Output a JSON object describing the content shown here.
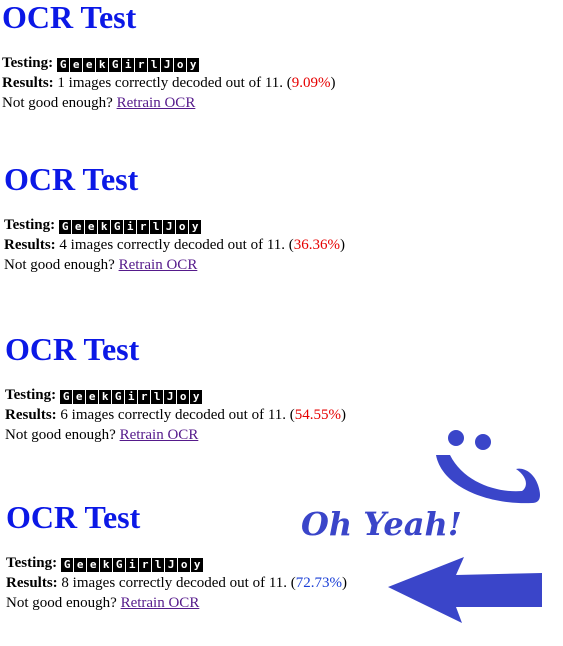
{
  "glyph_text": [
    "G",
    "e",
    "e",
    "k",
    "G",
    "i",
    "r",
    "l",
    "J",
    "o",
    "y"
  ],
  "panels": [
    {
      "title": "OCR Test",
      "testing_label": "Testing:",
      "results_label": "Results:",
      "results_text": " 1 images correctly decoded out of 11. (",
      "percent": "9.09%",
      "percent_color": "#e60000",
      "results_close": ")",
      "retrain_prompt": "Not good enough? ",
      "retrain_link": "Retrain OCR"
    },
    {
      "title": "OCR Test",
      "testing_label": "Testing:",
      "results_label": "Results:",
      "results_text": " 4 images correctly decoded out of 11. (",
      "percent": "36.36%",
      "percent_color": "#e60000",
      "results_close": ")",
      "retrain_prompt": "Not good enough? ",
      "retrain_link": "Retrain OCR"
    },
    {
      "title": "OCR Test",
      "testing_label": "Testing:",
      "results_label": "Results:",
      "results_text": " 6 images correctly decoded out of 11. (",
      "percent": "54.55%",
      "percent_color": "#e60000",
      "results_close": ")",
      "retrain_prompt": "Not good enough? ",
      "retrain_link": "Retrain OCR"
    },
    {
      "title": "OCR Test",
      "testing_label": "Testing:",
      "results_label": "Results:",
      "results_text": " 8 images correctly decoded out of 11. (",
      "percent": "72.73%",
      "percent_color": "#1a3fd6",
      "results_close": ")",
      "retrain_prompt": "Not good enough? ",
      "retrain_link": "Retrain OCR"
    }
  ],
  "overlay": {
    "caption": "Oh Yeah!",
    "accent_color": "#3a45c9",
    "smiley_icon": "smiley-face-icon",
    "arrow_icon": "left-arrow-icon"
  }
}
